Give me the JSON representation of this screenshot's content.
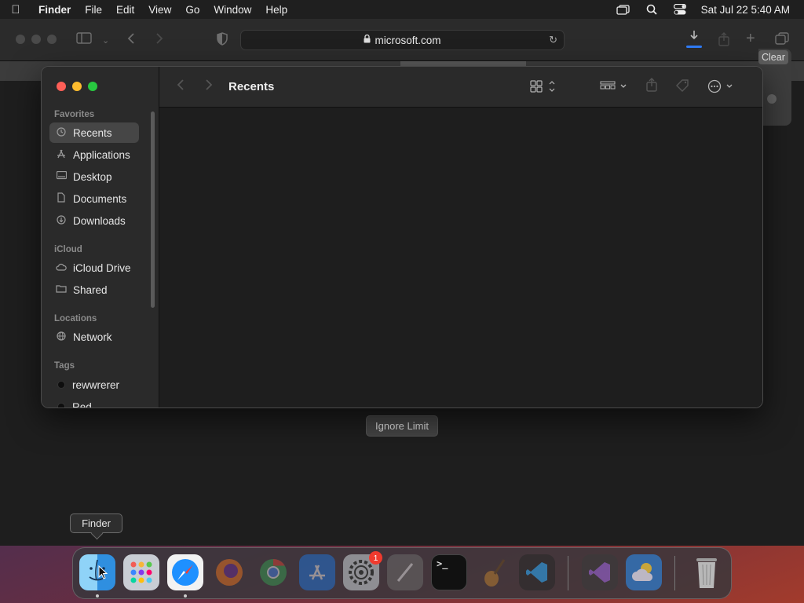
{
  "menubar": {
    "apple_icon": "apple-logo-icon",
    "items": [
      "Finder",
      "File",
      "Edit",
      "View",
      "Go",
      "Window",
      "Help"
    ],
    "status_icons": [
      "screen-mirroring-icon",
      "search-icon",
      "control-center-icon"
    ],
    "datetime": "Sat Jul 22  5:40 AM"
  },
  "safari": {
    "address": "microsoft.com",
    "clear_label": "Clear",
    "ignore_limit_label": "Ignore Limit",
    "accent": "#2f7bf5"
  },
  "finder": {
    "title": "Recents",
    "sidebar": {
      "favorites_heading": "Favorites",
      "favorites": [
        {
          "label": "Recents",
          "icon": "clock-icon",
          "selected": true
        },
        {
          "label": "Applications",
          "icon": "applications-icon"
        },
        {
          "label": "Desktop",
          "icon": "desktop-icon"
        },
        {
          "label": "Documents",
          "icon": "document-icon"
        },
        {
          "label": "Downloads",
          "icon": "download-icon"
        }
      ],
      "icloud_heading": "iCloud",
      "icloud": [
        {
          "label": "iCloud Drive",
          "icon": "cloud-icon"
        },
        {
          "label": "Shared",
          "icon": "shared-folder-icon"
        }
      ],
      "locations_heading": "Locations",
      "locations": [
        {
          "label": "Network",
          "icon": "globe-icon"
        }
      ],
      "tags_heading": "Tags",
      "tags": [
        {
          "label": "rewwrerer",
          "color": "#111111"
        },
        {
          "label": "Red",
          "color": "#111111"
        }
      ]
    }
  },
  "tooltip": "Finder",
  "dock": {
    "apps": [
      "Finder",
      "Launchpad",
      "Safari",
      "Firefox",
      "Chrome",
      "App Store",
      "System Settings",
      "Script Editor",
      "Terminal",
      "GarageBand",
      "Visual Studio Code",
      "Visual Studio",
      "Weather",
      "Trash"
    ],
    "settings_badge": "1"
  }
}
